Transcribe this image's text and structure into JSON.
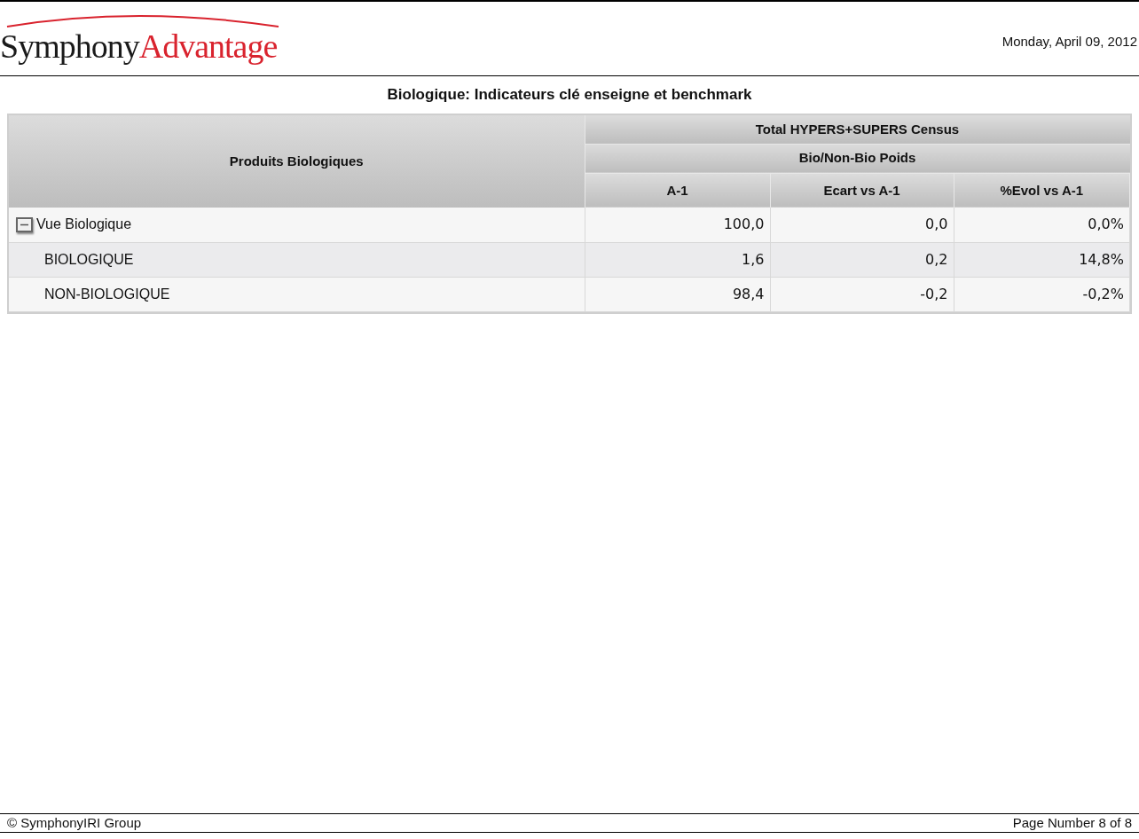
{
  "header": {
    "logo": {
      "part_1": "Symphony",
      "part_2": "Advantage"
    },
    "date": "Monday, April 09, 2012"
  },
  "report": {
    "title": "Biologique: Indicateurs clé enseigne et benchmark"
  },
  "table": {
    "row_header": "Produits Biologiques",
    "group": "Total HYPERS+SUPERS Census",
    "subgroup": "Bio/Non-Bio Poids",
    "columns": [
      "A-1",
      "Ecart vs A-1",
      "%Evol vs A-1"
    ],
    "rows": [
      {
        "label": "Vue Biologique",
        "expanded": true,
        "values": [
          "100,0",
          "0,0",
          "0,0%"
        ],
        "children": [
          {
            "label": "BIOLOGIQUE",
            "values": [
              "1,6",
              "0,2",
              "14,8%"
            ]
          },
          {
            "label": "NON-BIOLOGIQUE",
            "values": [
              "98,4",
              "-0,2",
              "-0,2%"
            ]
          }
        ]
      }
    ]
  },
  "footer": {
    "copyright": "© SymphonyIRI Group",
    "page": "Page Number 8 of 8"
  }
}
